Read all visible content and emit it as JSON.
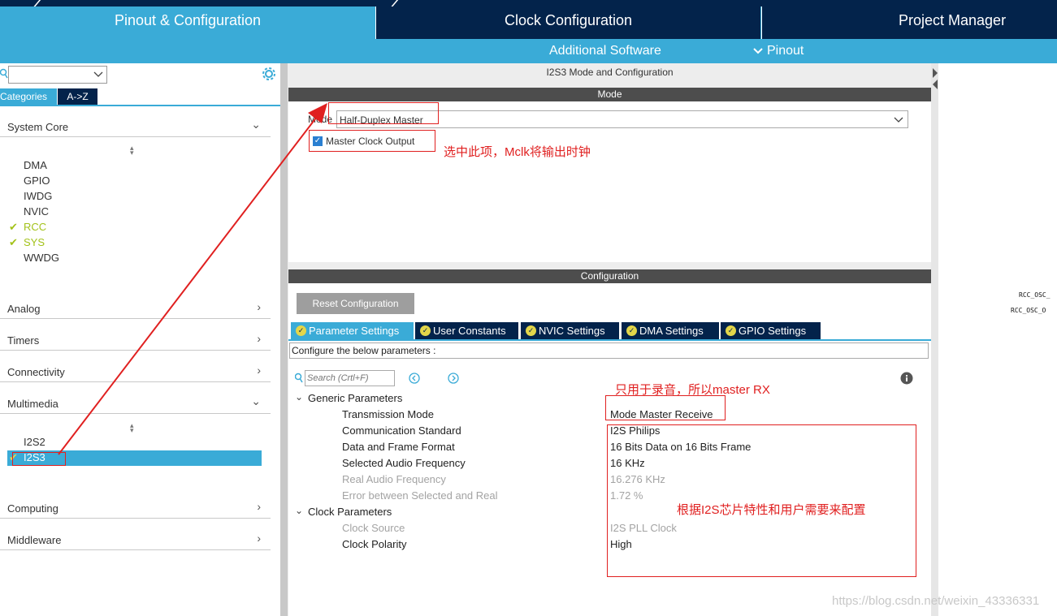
{
  "tabs": {
    "pinout": "Pinout & Configuration",
    "clock": "Clock Configuration",
    "project": "Project Manager"
  },
  "subnav": {
    "additional_software": "Additional Software",
    "pinout": "Pinout",
    "chevron": "chevron-down-icon"
  },
  "left": {
    "search_value": "",
    "view_tabs": [
      "Categories",
      "A->Z"
    ],
    "system_core": {
      "label": "System Core",
      "items": [
        "DMA",
        "GPIO",
        "IWDG",
        "NVIC",
        "RCC",
        "SYS",
        "WWDG"
      ]
    },
    "categories": [
      "Analog",
      "Timers",
      "Connectivity",
      "Multimedia",
      "Computing",
      "Middleware"
    ],
    "multimedia_items": [
      "I2S2",
      "I2S3"
    ]
  },
  "mode_panel": {
    "title": "I2S3 Mode and Configuration",
    "section": "Mode",
    "mode_label": "Mode",
    "mode_value": "Half-Duplex Master",
    "mclk_label": "Master Clock Output",
    "mclk_checked": true,
    "annotation": "选中此项，Mclk将输出时钟"
  },
  "config_panel": {
    "section": "Configuration",
    "reset_button": "Reset Configuration",
    "tabs": [
      "Parameter Settings",
      "User Constants",
      "NVIC Settings",
      "DMA Settings",
      "GPIO Settings"
    ],
    "hint": "Configure the below parameters :",
    "search_placeholder": "Search (Crtl+F)",
    "groups": {
      "generic": "Generic Parameters",
      "clock": "Clock Parameters"
    },
    "params": [
      {
        "name": "Transmission Mode",
        "value": "Mode Master Receive"
      },
      {
        "name": "Communication Standard",
        "value": "I2S Philips"
      },
      {
        "name": "Data and Frame Format",
        "value": "16 Bits Data on 16 Bits Frame"
      },
      {
        "name": "Selected Audio Frequency",
        "value": "16 KHz"
      },
      {
        "name": "Real Audio Frequency",
        "value": "16.276 KHz"
      },
      {
        "name": "Error between Selected and Real",
        "value": "1.72 %"
      },
      {
        "name": "Clock Source",
        "value": "I2S PLL Clock"
      },
      {
        "name": "Clock Polarity",
        "value": "High"
      }
    ],
    "annotation_rx": "只用于录音，所以master RX",
    "annotation_cfg": "根据I2S芯片特性和用户需要来配置"
  },
  "right": {
    "pin1": "RCC_OSC_",
    "pin2": "RCC_OSC_O"
  },
  "watermark": "https://blog.csdn.net/weixin_43336331",
  "colors": {
    "navy": "#03234b",
    "blue": "#3aabd7",
    "green": "#a3c21a",
    "annotation_red": "#e02020"
  }
}
